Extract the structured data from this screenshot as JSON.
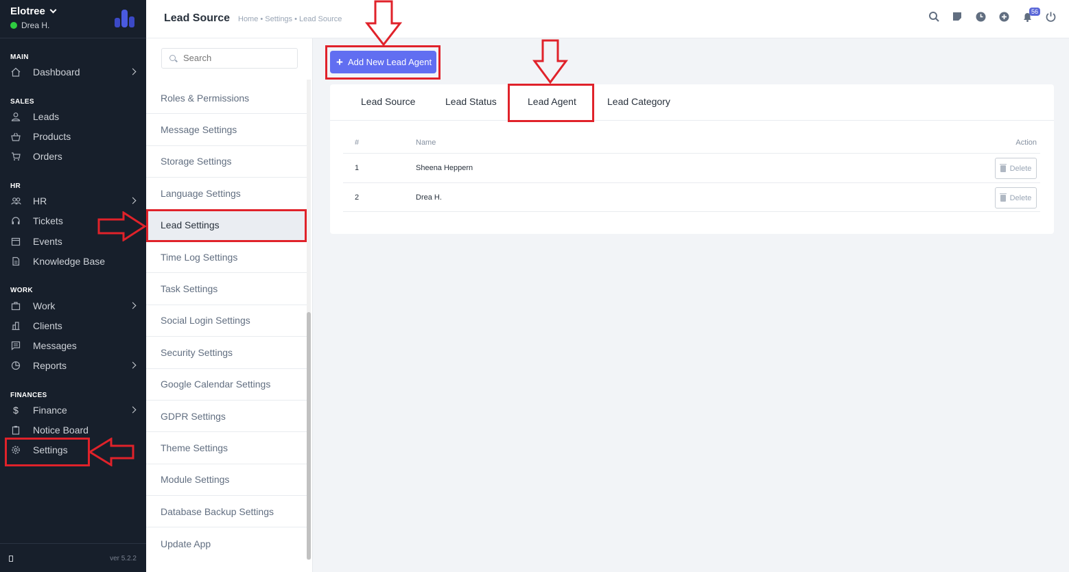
{
  "sidebar": {
    "company": "Elotree",
    "user": "Drea H.",
    "sections": {
      "main": "MAIN",
      "sales": "SALES",
      "hr": "HR",
      "work": "WORK",
      "finances": "FINANCES"
    },
    "items": {
      "dashboard": "Dashboard",
      "leads": "Leads",
      "products": "Products",
      "orders": "Orders",
      "hr": "HR",
      "tickets": "Tickets",
      "events": "Events",
      "knowledge_base": "Knowledge Base",
      "work": "Work",
      "clients": "Clients",
      "messages": "Messages",
      "reports": "Reports",
      "finance": "Finance",
      "notice_board": "Notice Board",
      "settings": "Settings"
    },
    "version": "ver 5.2.2"
  },
  "header": {
    "title": "Lead Source",
    "breadcrumb": "Home • Settings • Lead Source",
    "notification_count": "56"
  },
  "settings_menu": {
    "search_placeholder": "Search",
    "items": [
      "Roles & Permissions",
      "Message Settings",
      "Storage Settings",
      "Language Settings",
      "Lead Settings",
      "Time Log Settings",
      "Task Settings",
      "Social Login Settings",
      "Security Settings",
      "Google Calendar Settings",
      "GDPR Settings",
      "Theme Settings",
      "Module Settings",
      "Database Backup Settings",
      "Update App"
    ],
    "active": "Lead Settings"
  },
  "content": {
    "add_button": "Add New Lead Agent",
    "tabs": [
      "Lead Source",
      "Lead Status",
      "Lead Agent",
      "Lead Category"
    ],
    "active_tab": "Lead Agent",
    "table": {
      "headers": [
        "#",
        "Name",
        "Action"
      ],
      "rows": [
        {
          "num": "1",
          "name": "Sheena Heppern",
          "action": "Delete"
        },
        {
          "num": "2",
          "name": "Drea H.",
          "action": "Delete"
        }
      ]
    }
  },
  "colors": {
    "sidebar_bg": "#171f2b",
    "accent": "#616ef1",
    "annotation_red": "#e0222a"
  }
}
